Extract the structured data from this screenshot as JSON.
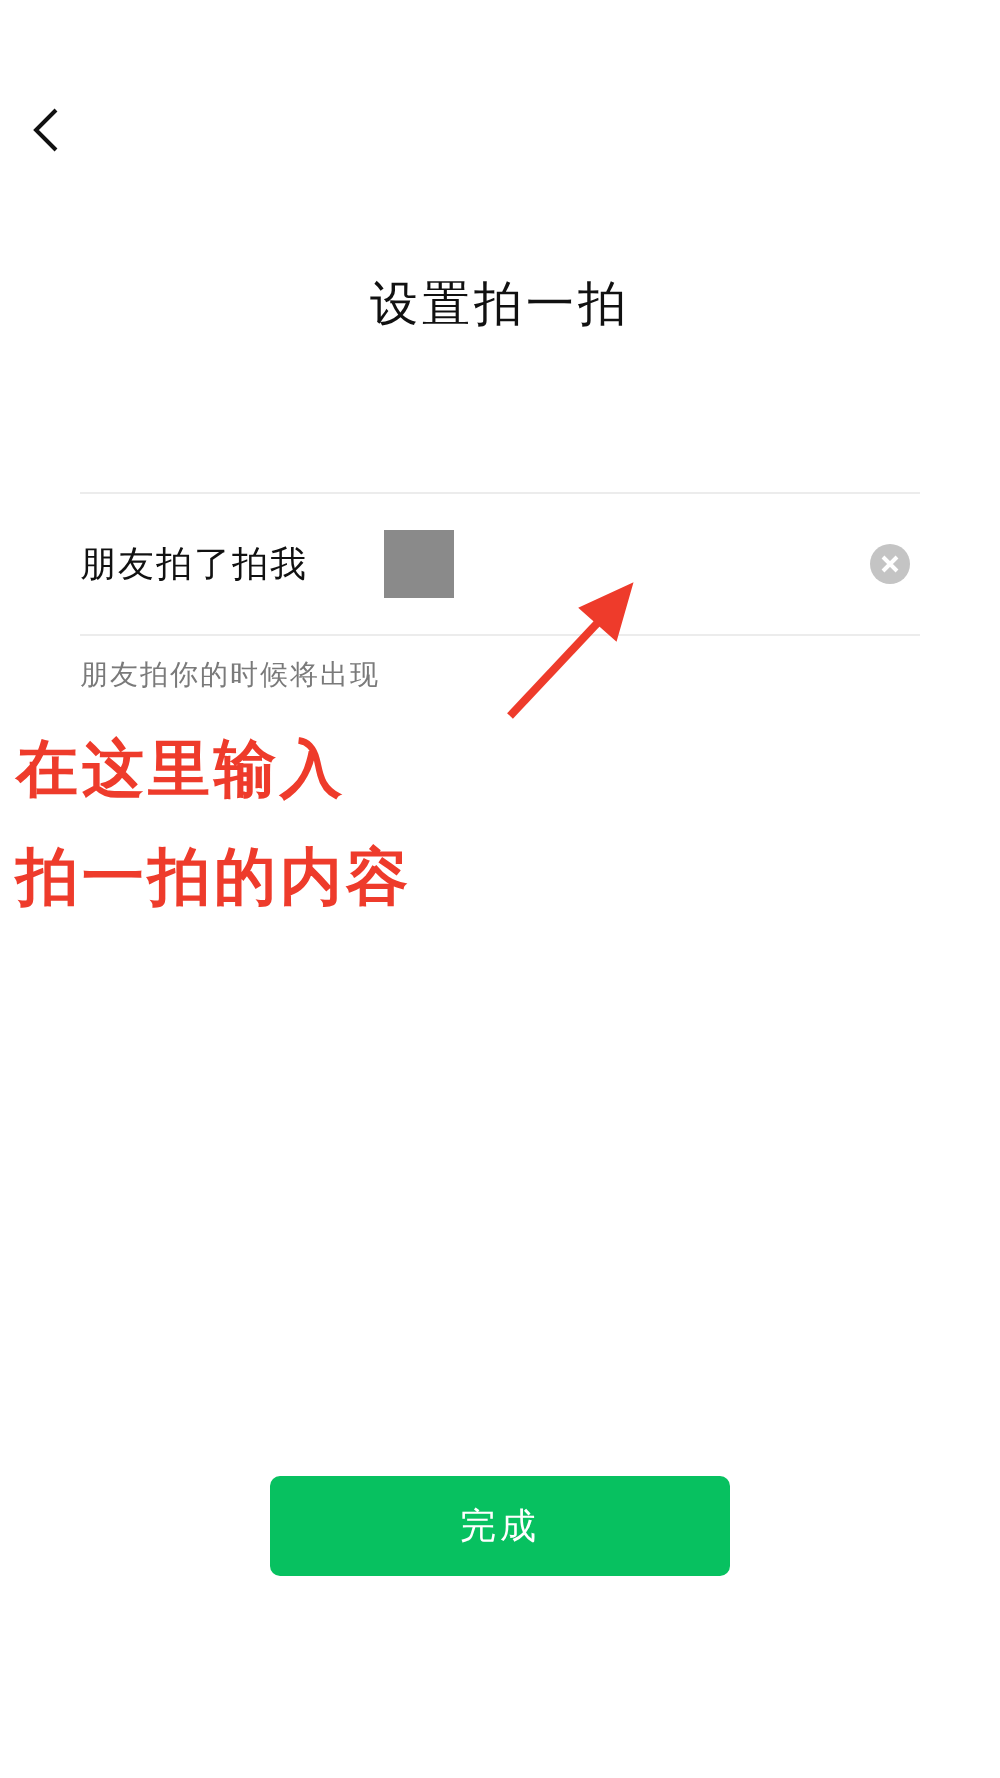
{
  "title": "设置拍一拍",
  "field": {
    "value": "朋友拍了拍我",
    "redacted": true
  },
  "hint": "朋友拍你的时候将出现",
  "annotation": {
    "lines": [
      "在这里输入",
      "拍一拍的内容"
    ],
    "color": "#ee3b2b"
  },
  "button": "完成"
}
